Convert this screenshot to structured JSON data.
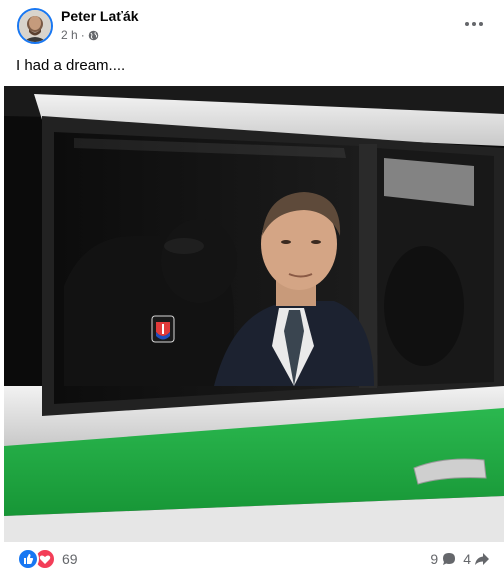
{
  "post": {
    "author": "Peter Laťák",
    "time": "2 h",
    "separator": "·",
    "privacy_icon": "globe-icon",
    "more_icon": "more-options-icon",
    "caption": "I had a dream....",
    "photo_icon": "photo-police-car"
  },
  "footer": {
    "reactions": [
      "like-icon",
      "love-icon"
    ],
    "reaction_count": "69",
    "comments_count": "9",
    "shares_count": "4"
  },
  "colors": {
    "brand_blue": "#1877f2",
    "love_red": "#f33e58",
    "secondary_text": "#65676b",
    "car_green": "#1fa84a"
  }
}
